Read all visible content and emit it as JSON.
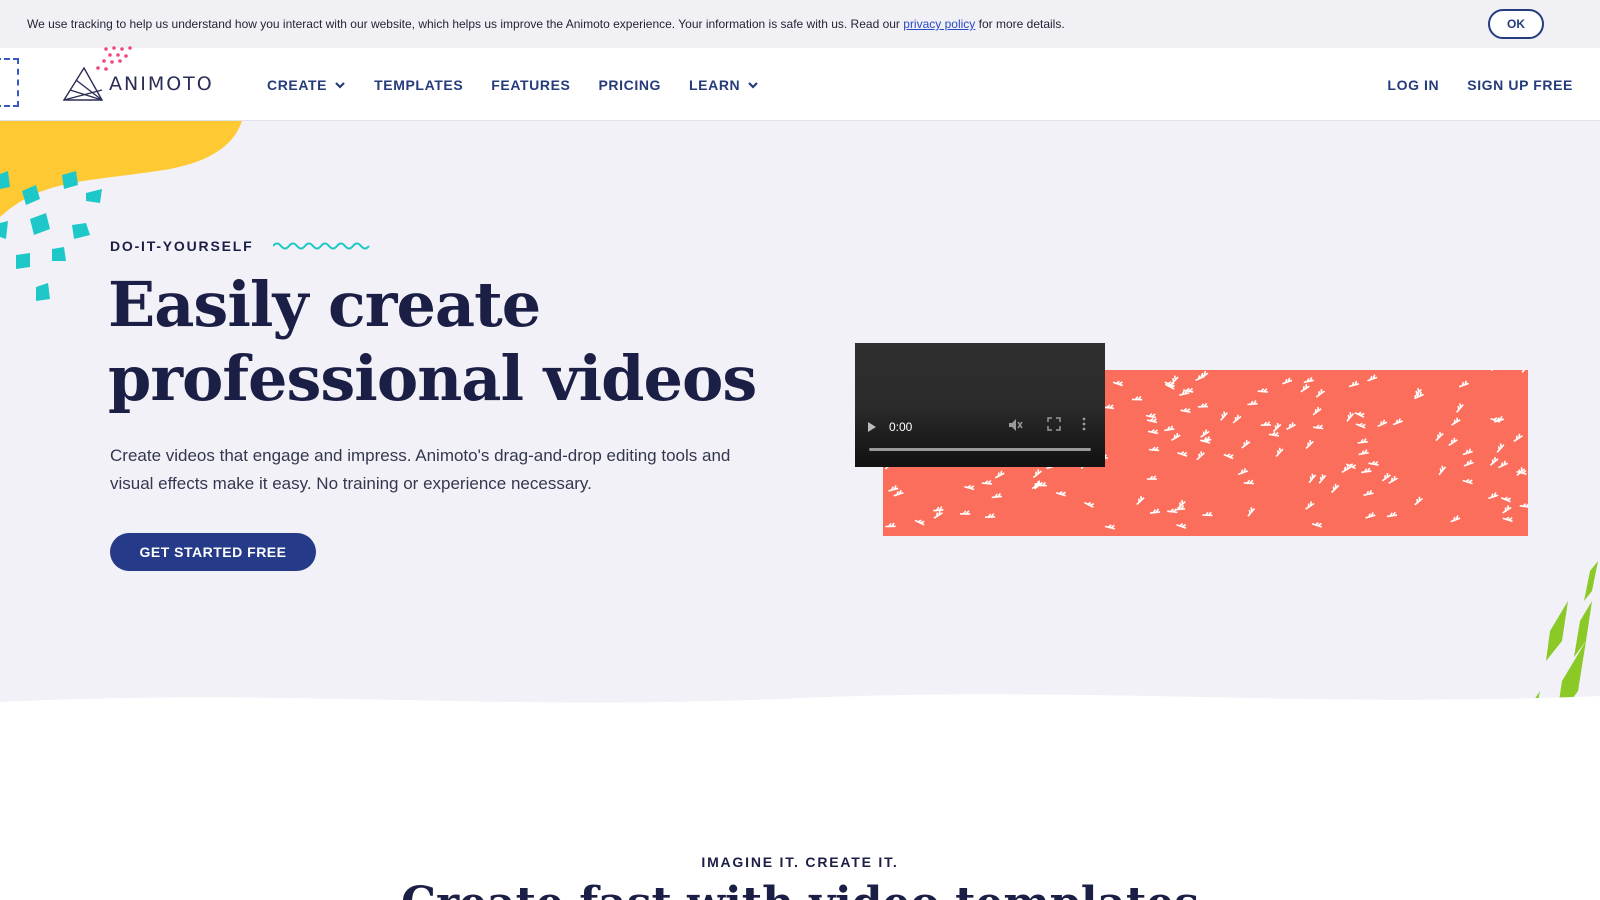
{
  "cookie": {
    "text_before": "We use tracking to help us understand how you interact with our website, which helps us improve the Animoto experience. Your information is safe with us. Read our ",
    "link_text": "privacy policy",
    "text_after": " for more details.",
    "ok_label": "OK"
  },
  "brand": {
    "name": "ANIMOTO"
  },
  "nav": {
    "left": [
      {
        "label": "CREATE",
        "dropdown": true
      },
      {
        "label": "TEMPLATES",
        "dropdown": false
      },
      {
        "label": "FEATURES",
        "dropdown": false
      },
      {
        "label": "PRICING",
        "dropdown": false
      },
      {
        "label": "LEARN",
        "dropdown": true
      }
    ],
    "login": "LOG IN",
    "signup": "SIGN UP FREE"
  },
  "hero": {
    "eyebrow": "DO-IT-YOURSELF",
    "headline_line1": "Easily create",
    "headline_line2": "professional videos",
    "body": "Create videos that engage and impress. Animoto's drag-and-drop editing tools and visual effects make it easy. No training or experience necessary.",
    "cta": "GET STARTED FREE",
    "video_time": "0:00"
  },
  "section": {
    "eyebrow": "IMAGINE IT. CREATE IT.",
    "headline": "Create fast with video templates"
  },
  "colors": {
    "navy": "#253b7c",
    "heading": "#1b1f45",
    "hero_bg": "#f2f1f7",
    "coral": "#fb6e5b",
    "yellow": "#ffc933",
    "teal": "#1fc8c8",
    "green": "#8ac926",
    "pink": "#f0477e"
  },
  "icons": [
    "chevron-down-icon",
    "animoto-logo-icon",
    "play-icon",
    "mute-icon",
    "fullscreen-icon",
    "more-icon",
    "wave-icon"
  ]
}
